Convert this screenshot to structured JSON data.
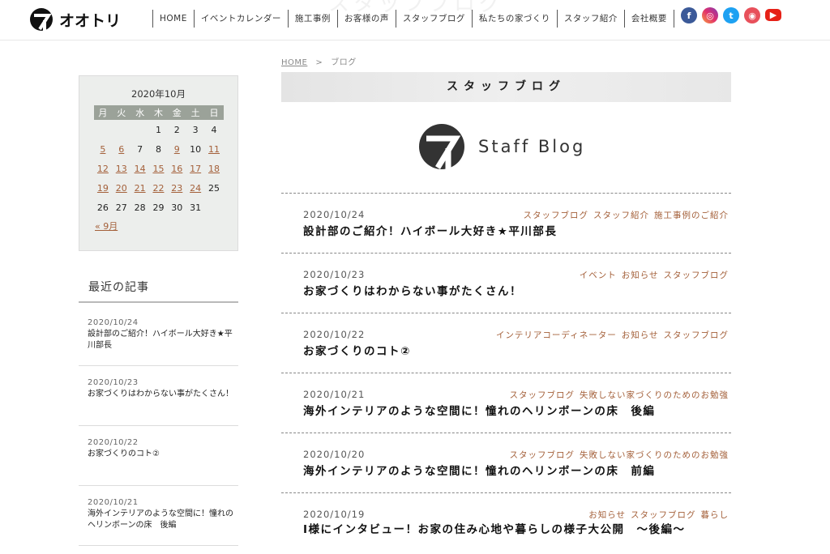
{
  "header": {
    "ghost_text": "スタッフブログ",
    "logo_text": "オオトリ",
    "nav": [
      "HOME",
      "イベントカレンダー",
      "施工事例",
      "お客様の声",
      "スタッフブログ",
      "私たちの家づくり",
      "スタッフ紹介",
      "会社概要"
    ],
    "social": [
      {
        "name": "facebook",
        "glyph": "f",
        "color": "#3b5998"
      },
      {
        "name": "instagram",
        "glyph": "◎",
        "color": "#e1306c"
      },
      {
        "name": "twitter",
        "glyph": "t",
        "color": "#1da1f2"
      },
      {
        "name": "camera",
        "glyph": "◉",
        "color": "#e8505b"
      },
      {
        "name": "youtube",
        "glyph": "▶",
        "color": "#e62117"
      }
    ]
  },
  "calendar": {
    "caption": "2020年10月",
    "weekdays": [
      "月",
      "火",
      "水",
      "木",
      "金",
      "土",
      "日"
    ],
    "weeks": [
      [
        "",
        "",
        "",
        "1",
        "2",
        "3",
        "4"
      ],
      [
        "5",
        "6",
        "7",
        "8",
        "9",
        "10",
        "11"
      ],
      [
        "12",
        "13",
        "14",
        "15",
        "16",
        "17",
        "18"
      ],
      [
        "19",
        "20",
        "21",
        "22",
        "23",
        "24",
        "25"
      ],
      [
        "26",
        "27",
        "28",
        "29",
        "30",
        "31",
        ""
      ]
    ],
    "linked_days": [
      "5",
      "6",
      "9",
      "11",
      "12",
      "13",
      "14",
      "15",
      "16",
      "17",
      "18",
      "19",
      "20",
      "21",
      "22",
      "23",
      "24"
    ],
    "prev_link": "« 9月"
  },
  "recent": {
    "title": "最近の記事",
    "items": [
      {
        "date": "2020/10/24",
        "text": "設計部のご紹介！ハイボール大好き★平川部長"
      },
      {
        "date": "2020/10/23",
        "text": "お家づくりはわからない事がたくさん！"
      },
      {
        "date": "2020/10/22",
        "text": "お家づくりのコト②"
      },
      {
        "date": "2020/10/21",
        "text": "海外インテリアのような空間に！憧れのヘリンボーンの床　後編"
      }
    ]
  },
  "breadcrumb": {
    "home": "HOME",
    "sep": ">",
    "current": "ブログ"
  },
  "page_title": "スタッフブログ",
  "staff_logo_text": "Staff Blog",
  "posts": [
    {
      "date": "2020/10/24",
      "cats": [
        "スタッフブログ",
        "スタッフ紹介",
        "施工事例のご紹介"
      ],
      "title": "設計部のご紹介！ハイボール大好き★平川部長"
    },
    {
      "date": "2020/10/23",
      "cats": [
        "イベント",
        "お知らせ",
        "スタッフブログ"
      ],
      "title": "お家づくりはわからない事がたくさん！"
    },
    {
      "date": "2020/10/22",
      "cats": [
        "インテリアコーディネーター",
        "お知らせ",
        "スタッフブログ"
      ],
      "title": "お家づくりのコト②"
    },
    {
      "date": "2020/10/21",
      "cats": [
        "スタッフブログ",
        "失敗しない家づくりのためのお勉強"
      ],
      "title": "海外インテリアのような空間に！憧れのヘリンボーンの床　後編"
    },
    {
      "date": "2020/10/20",
      "cats": [
        "スタッフブログ",
        "失敗しない家づくりのためのお勉強"
      ],
      "title": "海外インテリアのような空間に！憧れのヘリンボーンの床　前編"
    },
    {
      "date": "2020/10/19",
      "cats": [
        "お知らせ",
        "スタッフブログ",
        "暮らし"
      ],
      "title": "I様にインタビュー！お家の住み心地や暮らしの様子大公開　～後編～"
    }
  ],
  "colors": {
    "link": "#a4603a",
    "calendar_header": "#9ba299",
    "calendar_bg": "#eceeec"
  }
}
